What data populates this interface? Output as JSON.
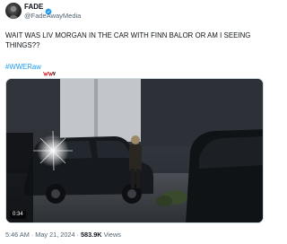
{
  "author": {
    "display_name": "FADE",
    "handle": "@FadeAwayMedia",
    "verified": true,
    "avatar_icon": "profile-avatar"
  },
  "tweet": {
    "text": "WAIT WAS LIV MORGAN IN THE CAR WITH FINN BALOR OR AM I SEEING THINGS??",
    "hashtag": "#WWERaw",
    "hashflag_icon": "wwe-raw-hashflag-icon"
  },
  "media": {
    "type": "video",
    "duration": "0:34"
  },
  "meta": {
    "time": "5:46 AM",
    "separator": "·",
    "date": "May 21, 2024",
    "views_count": "583.9K",
    "views_label": "Views"
  },
  "colors": {
    "link": "#1d9bf0",
    "verified": "#1d9bf0",
    "secondary_text": "#536471",
    "primary_text": "#0f1419",
    "border": "#cfd9de"
  }
}
